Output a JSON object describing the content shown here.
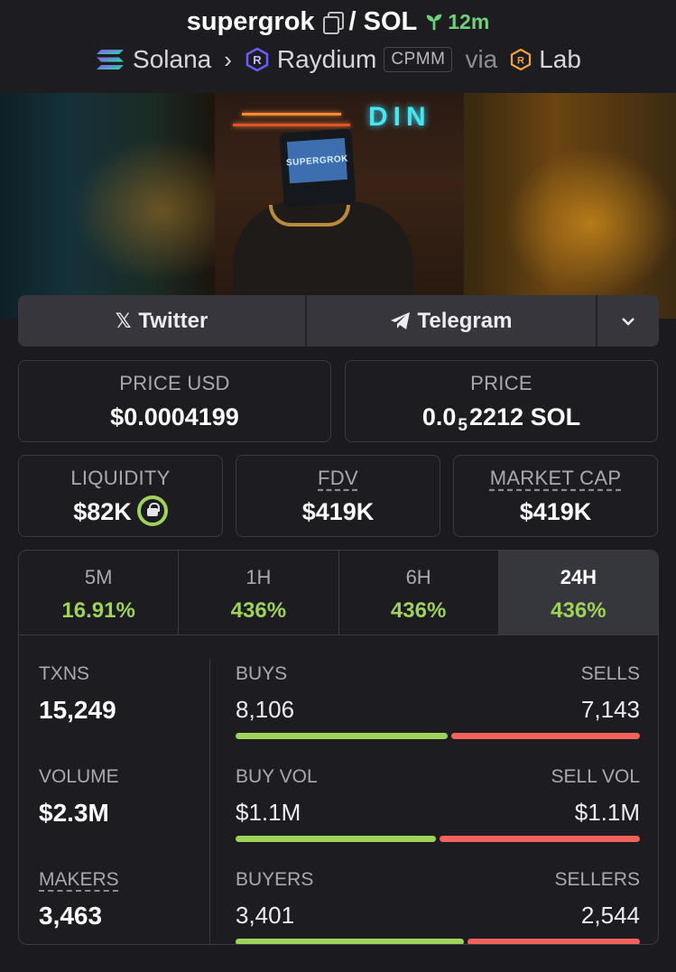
{
  "header": {
    "token": "supergrok",
    "pair_sep": "/",
    "quote": "SOL",
    "age": "12m",
    "chain": "Solana",
    "dex": "Raydium",
    "pool_type": "CPMM",
    "via_label": "via",
    "via": "Lab"
  },
  "banner": {
    "sign_text": "DIN",
    "screen_text": "SUPERGROK"
  },
  "links": {
    "twitter": "Twitter",
    "telegram": "Telegram"
  },
  "price": {
    "usd_label": "PRICE USD",
    "usd_value": "$0.0004199",
    "native_label": "PRICE",
    "native_prefix": "0.0",
    "native_zeros": "5",
    "native_digits": "2212",
    "native_unit": "SOL"
  },
  "market": {
    "liquidity_label": "LIQUIDITY",
    "liquidity_value": "$82K",
    "fdv_label": "FDV",
    "fdv_value": "$419K",
    "mcap_label": "MARKET CAP",
    "mcap_value": "$419K"
  },
  "tabs": [
    {
      "label": "5M",
      "change": "16.91%"
    },
    {
      "label": "1H",
      "change": "436%"
    },
    {
      "label": "6H",
      "change": "436%"
    },
    {
      "label": "24H",
      "change": "436%"
    }
  ],
  "active_tab": "24H",
  "metrics": {
    "txns_label": "TXNS",
    "txns_value": "15,249",
    "volume_label": "VOLUME",
    "volume_value": "$2.3M",
    "makers_label": "MAKERS",
    "makers_value": "3,463"
  },
  "splits": {
    "buys_label": "BUYS",
    "buys_value": "8,106",
    "sells_label": "SELLS",
    "sells_value": "7,143",
    "buys_fraction": 0.53,
    "buyvol_label": "BUY VOL",
    "buyvol_value": "$1.1M",
    "sellvol_label": "SELL VOL",
    "sellvol_value": "$1.1M",
    "buyvol_fraction": 0.5,
    "buyers_label": "BUYERS",
    "buyers_value": "3,401",
    "sellers_label": "SELLERS",
    "sellers_value": "2,544",
    "buyers_fraction": 0.57
  },
  "colors": {
    "positive": "#9ed25a",
    "negative": "#f0625a",
    "age": "#6fd07a"
  }
}
